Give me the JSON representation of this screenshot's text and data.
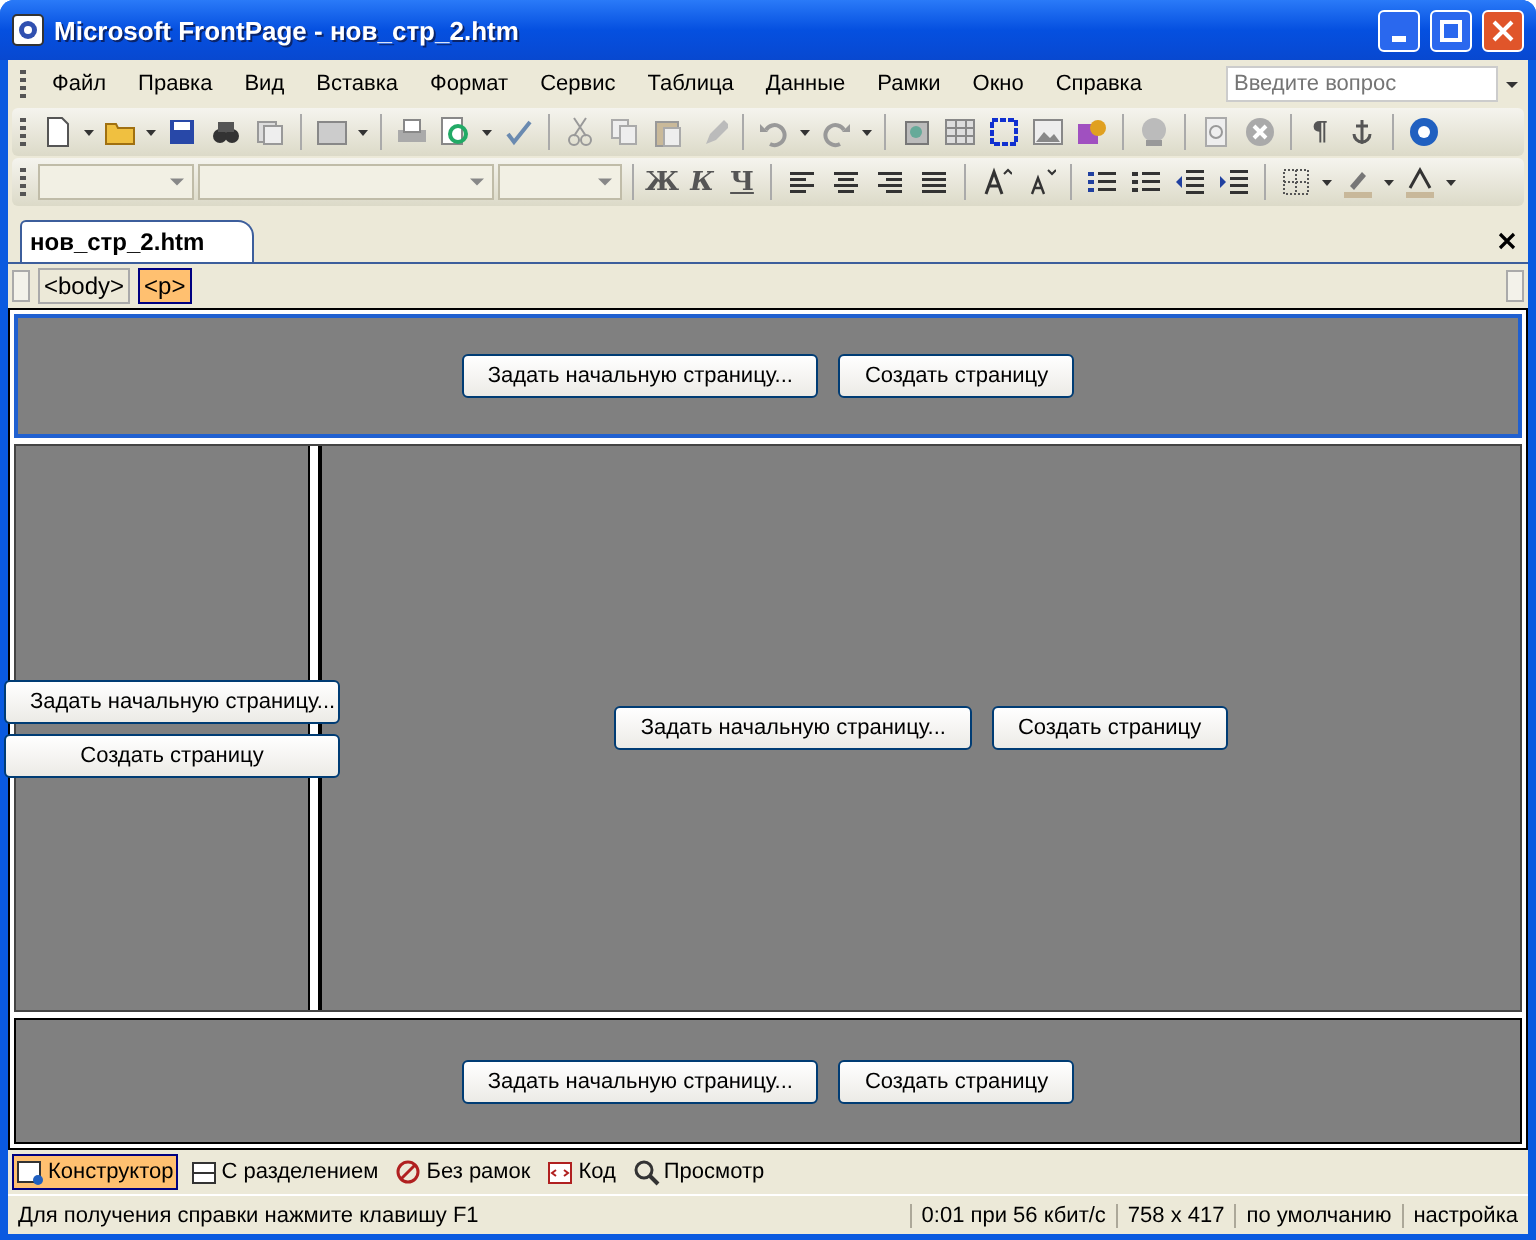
{
  "window": {
    "title": "Microsoft FrontPage - нов_стр_2.htm"
  },
  "menu": [
    "Файл",
    "Правка",
    "Вид",
    "Вставка",
    "Формат",
    "Сервис",
    "Таблица",
    "Данные",
    "Рамки",
    "Окно",
    "Справка"
  ],
  "help_search": {
    "placeholder": "Введите вопрос"
  },
  "standard_toolbar": {
    "pilcrow": "¶"
  },
  "format_toolbar": {
    "bold": "Ж",
    "italic": "К",
    "underline": "Ч"
  },
  "document_tabs": [
    {
      "label": "нов_стр_2.htm",
      "selected": true
    }
  ],
  "tag_selector": [
    {
      "label": "<body>",
      "selected": false
    },
    {
      "label": "<p>",
      "selected": true
    }
  ],
  "frames": [
    {
      "kind": "banner",
      "selected": true,
      "buttons": [
        "Задать начальную страницу...",
        "Создать страницу"
      ]
    },
    {
      "kind": "contents",
      "selected": false,
      "buttons": [
        "Задать начальную страницу...",
        "Создать страницу"
      ]
    },
    {
      "kind": "main",
      "selected": false,
      "buttons": [
        "Задать начальную страницу...",
        "Создать страницу"
      ]
    },
    {
      "kind": "footer",
      "selected": false,
      "buttons": [
        "Задать начальную страницу...",
        "Создать страницу"
      ]
    }
  ],
  "view_tabs": [
    {
      "label": "Конструктор",
      "selected": true
    },
    {
      "label": "С разделением",
      "selected": false
    },
    {
      "label": "Без рамок",
      "selected": false
    },
    {
      "label": "Код",
      "selected": false
    },
    {
      "label": "Просмотр",
      "selected": false
    }
  ],
  "status_bar": [
    "Для получения справки нажмите клавишу F1",
    "0:01 при 56 кбит/с",
    "758 x 417",
    "по умолчанию",
    "настройка"
  ]
}
